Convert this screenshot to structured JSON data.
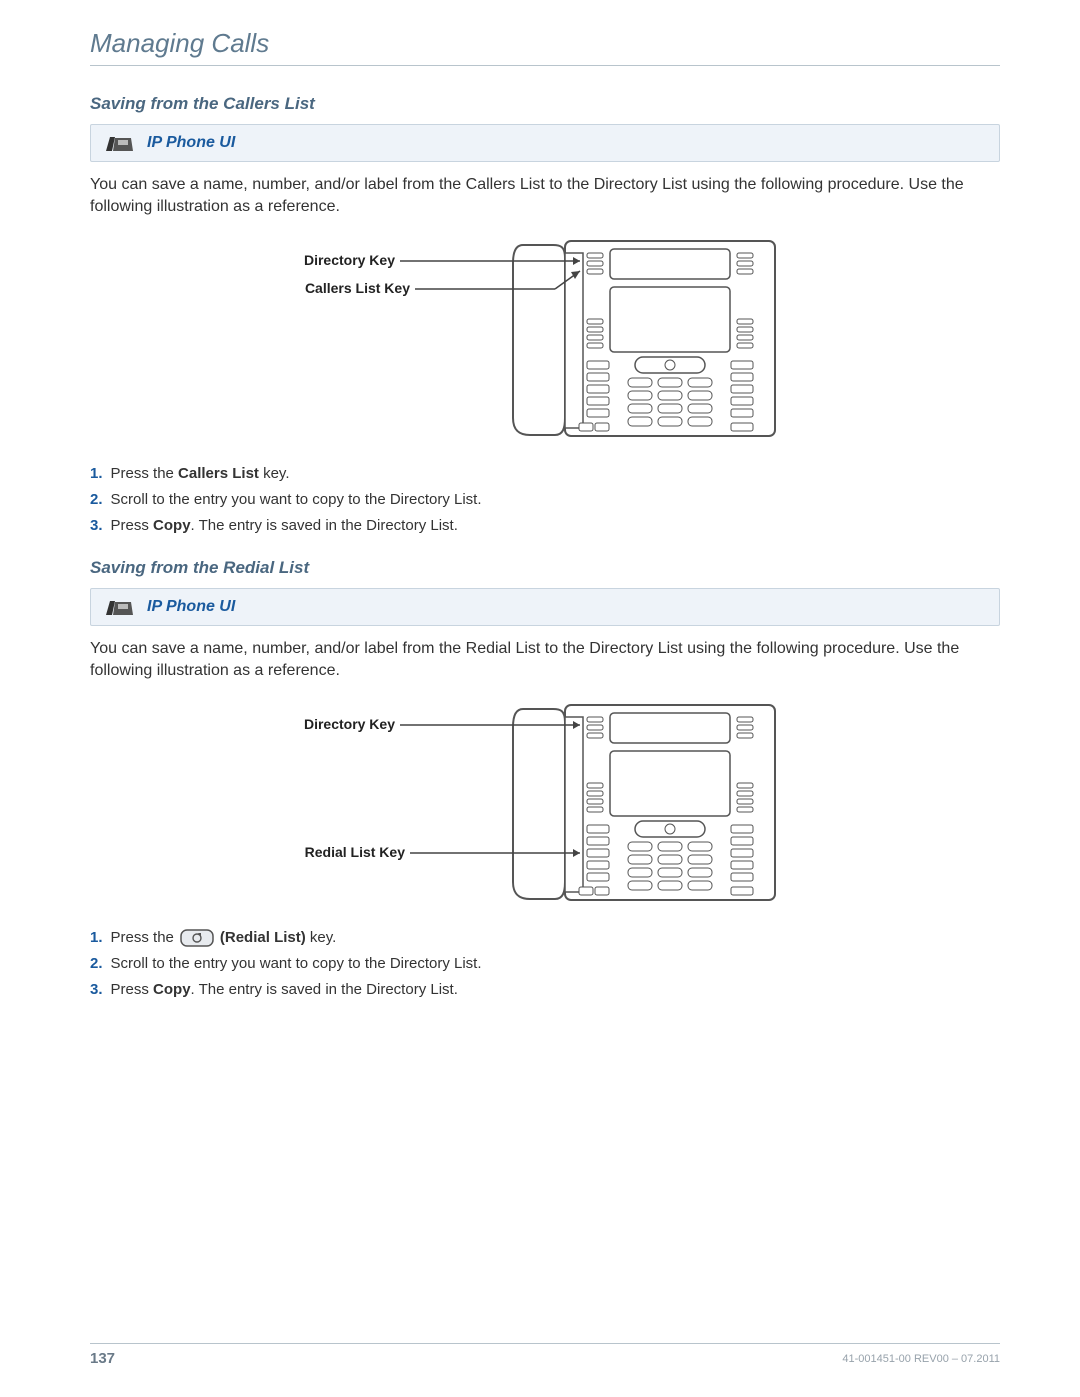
{
  "page_title": "Managing Calls",
  "section1": {
    "heading": "Saving from the Callers List",
    "ui_box_label": "IP Phone UI",
    "intro": "You can save a name, number, and/or label from the Callers List to the Directory List using the following procedure. Use the following illustration as a reference.",
    "callout_directory": "Directory Key",
    "callout_callers": "Callers List Key",
    "steps": {
      "s1_a": "Press the ",
      "s1_b": "Callers List",
      "s1_c": " key.",
      "s2": "Scroll to the entry you want to copy to the Directory List.",
      "s3_a": "Press ",
      "s3_b": "Copy",
      "s3_c": ". The entry is saved in the Directory List."
    }
  },
  "section2": {
    "heading": "Saving from the Redial List",
    "ui_box_label": "IP Phone UI",
    "intro": "You can save a name, number, and/or label from the Redial List to the Directory List using the following procedure. Use the following illustration as a reference.",
    "callout_directory": "Directory Key",
    "callout_redial": "Redial List Key",
    "steps": {
      "s1_a": "Press the",
      "s1_b": "(Redial List)",
      "s1_c": " key.",
      "s2": "Scroll to the entry you want to copy to the Directory List.",
      "s3_a": "Press ",
      "s3_b": "Copy",
      "s3_c": ". The entry is saved in the Directory List."
    }
  },
  "nums": {
    "n1": "1.",
    "n2": "2.",
    "n3": "3."
  },
  "footer": {
    "page_number": "137",
    "doc_id": "41-001451-00 REV00 – 07.2011"
  }
}
